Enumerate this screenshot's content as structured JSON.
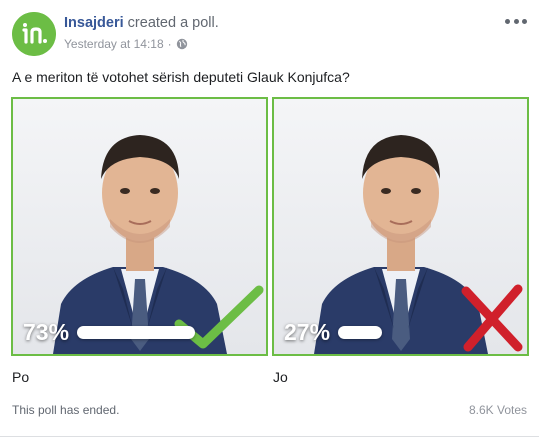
{
  "post": {
    "author": "Insajderi",
    "action": "created a poll.",
    "timestamp": "Yesterday at 14:18",
    "separator": "·",
    "privacy_icon": "globe-icon",
    "avatar_text": "in."
  },
  "poll": {
    "question": "A e meriton të votohet sërish deputeti Glauk Konjufca?",
    "accent_color": "#6cbd45",
    "options": [
      {
        "label": "Po",
        "percent_text": "73%",
        "percent": 73,
        "mark_icon": "checkmark-icon",
        "mark_color": "#6cbd45"
      },
      {
        "label": "Jo",
        "percent_text": "27%",
        "percent": 27,
        "mark_icon": "x-mark-icon",
        "mark_color": "#d0202b"
      }
    ],
    "status": "This poll has ended.",
    "votes": "8.6K Votes"
  }
}
